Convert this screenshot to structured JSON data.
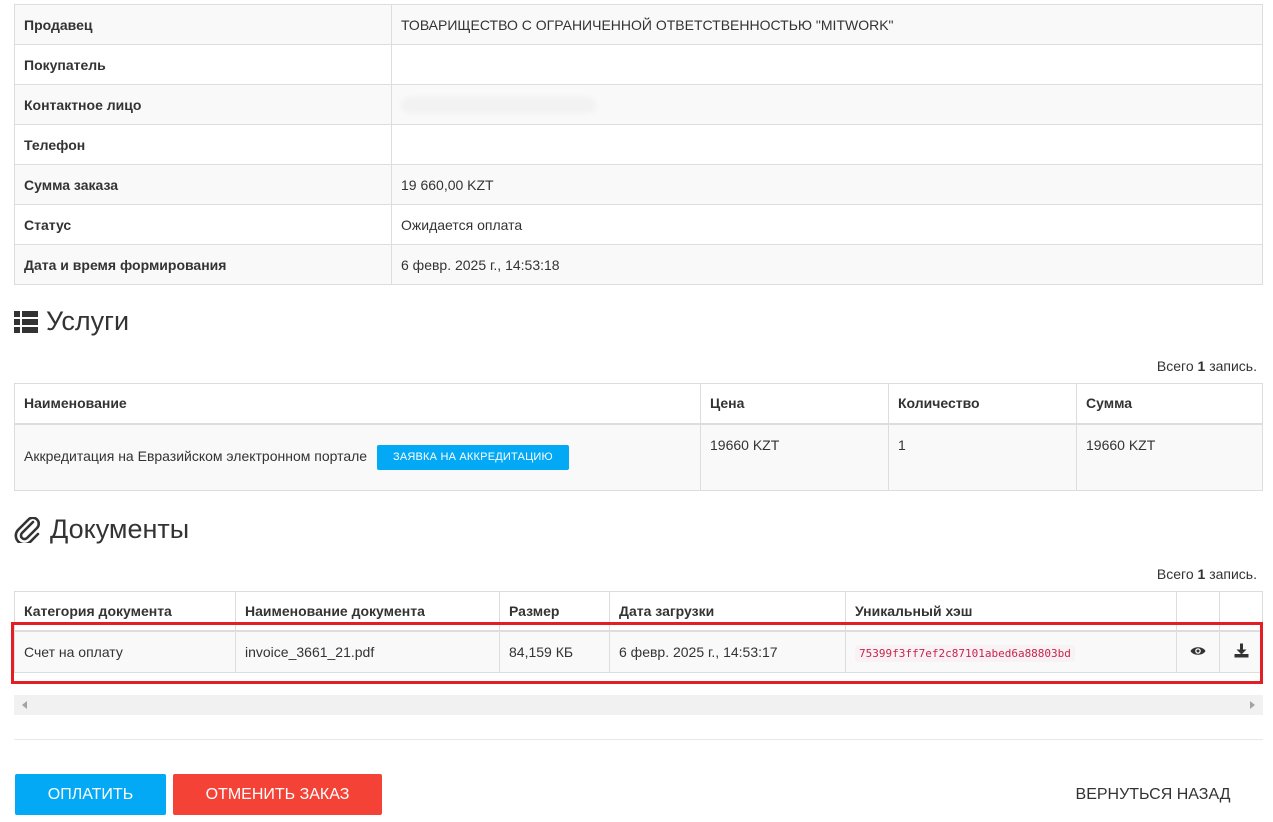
{
  "info": {
    "rows": [
      {
        "label": "Продавец",
        "value": "ТОВАРИЩЕСТВО С ОГРАНИЧЕННОЙ ОТВЕТСТВЕННОСТЬЮ \"MITWORK\""
      },
      {
        "label": "Покупатель",
        "value": ""
      },
      {
        "label": "Контактное лицо",
        "value": ""
      },
      {
        "label": "Телефон",
        "value": ""
      },
      {
        "label": "Сумма заказа",
        "value": "19 660,00 KZT"
      },
      {
        "label": "Статус",
        "value": "Ожидается оплата"
      },
      {
        "label": "Дата и время формирования",
        "value": "6 февр. 2025 г., 14:53:18"
      }
    ]
  },
  "services": {
    "title": "Услуги",
    "total_prefix": "Всего ",
    "total_count": "1",
    "total_suffix": " запись.",
    "headers": [
      "Наименование",
      "Цена",
      "Количество",
      "Сумма"
    ],
    "row": {
      "name": "Аккредитация на Евразийском электронном портале",
      "button": "ЗАЯВКА НА АККРЕДИТАЦИЮ",
      "price": "19660 KZT",
      "qty": "1",
      "sum": "19660 KZT"
    }
  },
  "documents": {
    "title": "Документы",
    "total_prefix": "Всего ",
    "total_count": "1",
    "total_suffix": " запись.",
    "headers": [
      "Категория документа",
      "Наименование документа",
      "Размер",
      "Дата загрузки",
      "Уникальный хэш",
      "",
      ""
    ],
    "row": {
      "category": "Счет на оплату",
      "name": "invoice_3661_21.pdf",
      "size": "84,159 КБ",
      "date": "6 февр. 2025 г., 14:53:17",
      "hash": "75399f3ff7ef2c87101abed6a88803bd"
    }
  },
  "actions": {
    "pay": "ОПЛАТИТЬ",
    "cancel": "ОТМЕНИТЬ ЗАКАЗ",
    "back": "ВЕРНУТЬСЯ НАЗАД"
  },
  "icons": {
    "services": "list-icon",
    "documents": "paperclip-icon",
    "view": "eye-icon",
    "download": "download-icon"
  },
  "colors": {
    "primary": "#03a9f4",
    "danger": "#f44336",
    "highlight": "#e31e24",
    "hash_text": "#c7254e"
  }
}
